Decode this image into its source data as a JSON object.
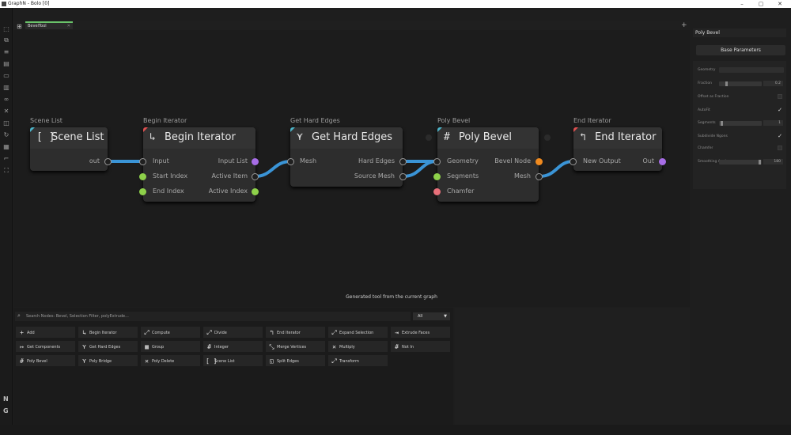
{
  "window": {
    "title": "GraphN - Bolo [0]",
    "minimize": "–",
    "maximize": "▢",
    "close": "✕"
  },
  "graph": {
    "tab_label": "BevelTool",
    "caption": "Generated tool from the current graph",
    "nodes": {
      "scene_list": {
        "label": "Scene List",
        "title": "Scene List",
        "icon": "[ ]",
        "out": "out"
      },
      "begin_iterator": {
        "label": "Begin Iterator",
        "title": "Begin Iterator",
        "icon": "↳",
        "inputs": [
          "Input",
          "Start Index",
          "End Index"
        ],
        "outputs": [
          "Input List",
          "Active Item",
          "Active Index"
        ]
      },
      "get_hard_edges": {
        "label": "Get Hard Edges",
        "title": "Get Hard Edges",
        "icon": "⋎",
        "inputs": [
          "Mesh"
        ],
        "outputs": [
          "Hard Edges",
          "Source Mesh"
        ]
      },
      "poly_bevel": {
        "label": "Poly Bevel",
        "title": "Poly Bevel",
        "icon": "#",
        "inputs": [
          "Geometry",
          "Segments",
          "Chamfer"
        ],
        "outputs": [
          "Bevel Node",
          "Mesh"
        ]
      },
      "end_iterator": {
        "label": "End Iterator",
        "title": "End Iterator",
        "icon": "↰",
        "inputs": [
          "New Output"
        ],
        "outputs": [
          "Out"
        ]
      }
    }
  },
  "properties": {
    "node_name": "Poly Bevel",
    "section": "Base Parameters",
    "rows": [
      {
        "name": "Geometry"
      },
      {
        "name": "Fraction",
        "value": "0.2"
      },
      {
        "name": "Offset as Fraction"
      },
      {
        "name": "AutoFit",
        "check": "✓"
      },
      {
        "name": "Segments",
        "value": "1"
      },
      {
        "name": "Subdivide Ngons",
        "check": "✓"
      },
      {
        "name": "Chamfer"
      },
      {
        "name": "Smoothing Angle",
        "value": "180"
      }
    ]
  },
  "library": {
    "search_placeholder": "Search Nodes: Bevel, Selection Filter, polyExtrude...",
    "filter_value": "All",
    "items": [
      {
        "icon": "+",
        "label": "Add"
      },
      {
        "icon": "↳",
        "label": "Begin Iterator"
      },
      {
        "icon": "⤢",
        "label": "Compute"
      },
      {
        "icon": "⤢",
        "label": "Divide"
      },
      {
        "icon": "↰",
        "label": "End Iterator"
      },
      {
        "icon": "⤢",
        "label": "Expand Selection"
      },
      {
        "icon": "⇥",
        "label": "Extrude Faces"
      },
      {
        "icon": "↦",
        "label": "Get Components"
      },
      {
        "icon": "⋎",
        "label": "Get Hard Edges"
      },
      {
        "icon": "▦",
        "label": "Group"
      },
      {
        "icon": "#",
        "label": "Integer"
      },
      {
        "icon": "⤡",
        "label": "Merge Vertices"
      },
      {
        "icon": "✕",
        "label": "Multiply"
      },
      {
        "icon": "#",
        "label": "Not In"
      },
      {
        "icon": "#",
        "label": "Poly Bevel"
      },
      {
        "icon": "⋎",
        "label": "Poly Bridge"
      },
      {
        "icon": "✕",
        "label": "Poly Delete"
      },
      {
        "icon": "[ ]",
        "label": "Scene List"
      },
      {
        "icon": "◱",
        "label": "Split Edges"
      },
      {
        "icon": "⤢",
        "label": "Transform"
      }
    ]
  },
  "bottom": {
    "logo_n": "N",
    "logo_g": "G"
  },
  "colors": {
    "wire": "#3a94d6",
    "int_port": "#8ed14a",
    "list_port": "#a76de6",
    "node_port": "#f08a1f",
    "bool_port": "#e8707a"
  }
}
